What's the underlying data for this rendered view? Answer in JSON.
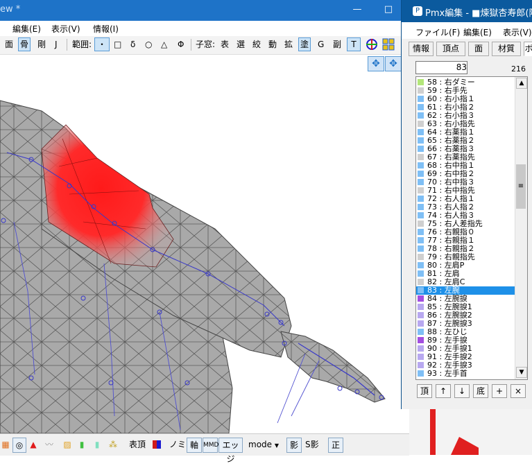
{
  "main": {
    "title": "ew *",
    "menu": [
      "編集(E)",
      "表示(V)",
      "情報(I)"
    ],
    "toolbar": {
      "mode_items": [
        "面",
        "骨",
        "剛",
        "J"
      ],
      "range_label": "範囲:",
      "range_items": [
        "・",
        "□",
        "δ",
        "○",
        "△",
        "Φ"
      ],
      "child_label": "子窓:",
      "child_items": [
        "表",
        "選",
        "絞",
        "動",
        "拡",
        "塗",
        "G",
        "副",
        "T"
      ]
    },
    "bottom": {
      "show_top": "表頂",
      "nomi": "ノミ",
      "axis": "軸",
      "mmd": "MMD",
      "edge": "エッジ",
      "mode": "mode",
      "shadow": "影",
      "s_shadow": "S影",
      "seimen": "正"
    }
  },
  "pmx": {
    "title": "Pmx編集 - ■煉獄杏寿郎(隊服",
    "menu": [
      "ファイル(F)",
      "編集(E)",
      "表示(V)"
    ],
    "tabs": [
      "情報",
      "頂点",
      "面",
      "材質",
      "ボ"
    ],
    "index_value": "83",
    "count": "216",
    "bones": [
      {
        "label": "58 : 右ダミー",
        "color": "#b3e67a"
      },
      {
        "label": "59 : 右手先",
        "color": "#cfcfcf"
      },
      {
        "label": "60 : 右小指１",
        "color": "#7fbff5"
      },
      {
        "label": "61 : 右小指２",
        "color": "#7fbff5"
      },
      {
        "label": "62 : 右小指３",
        "color": "#7fbff5"
      },
      {
        "label": "63 : 右小指先",
        "color": "#cfcfcf"
      },
      {
        "label": "64 : 右薬指１",
        "color": "#7fbff5"
      },
      {
        "label": "65 : 右薬指２",
        "color": "#7fbff5"
      },
      {
        "label": "66 : 右薬指３",
        "color": "#7fbff5"
      },
      {
        "label": "67 : 右薬指先",
        "color": "#cfcfcf"
      },
      {
        "label": "68 : 右中指１",
        "color": "#7fbff5"
      },
      {
        "label": "69 : 右中指２",
        "color": "#7fbff5"
      },
      {
        "label": "70 : 右中指３",
        "color": "#7fbff5"
      },
      {
        "label": "71 : 右中指先",
        "color": "#cfcfcf"
      },
      {
        "label": "72 : 右人指１",
        "color": "#7fbff5"
      },
      {
        "label": "73 : 右人指２",
        "color": "#7fbff5"
      },
      {
        "label": "74 : 右人指３",
        "color": "#7fbff5"
      },
      {
        "label": "75 : 右人差指先",
        "color": "#cfcfcf"
      },
      {
        "label": "76 : 右親指０",
        "color": "#7fbff5"
      },
      {
        "label": "77 : 右親指１",
        "color": "#7fbff5"
      },
      {
        "label": "78 : 右親指２",
        "color": "#7fbff5"
      },
      {
        "label": "79 : 右親指先",
        "color": "#cfcfcf"
      },
      {
        "label": "80 : 左肩P",
        "color": "#7fbff5"
      },
      {
        "label": "81 : 左肩",
        "color": "#7fbff5"
      },
      {
        "label": "82 : 左肩C",
        "color": "#cfcfcf"
      },
      {
        "label": "83 : 左腕",
        "color": "#7fbff5",
        "selected": true
      },
      {
        "label": "84 : 左腕捩",
        "color": "#a34ee0"
      },
      {
        "label": "85 : 左腕捩1",
        "color": "#b8a8f0"
      },
      {
        "label": "86 : 左腕捩2",
        "color": "#b8a8f0"
      },
      {
        "label": "87 : 左腕捩3",
        "color": "#b8a8f0"
      },
      {
        "label": "88 : 左ひじ",
        "color": "#7fbff5"
      },
      {
        "label": "89 : 左手捩",
        "color": "#a34ee0"
      },
      {
        "label": "90 : 左手捩1",
        "color": "#b8a8f0"
      },
      {
        "label": "91 : 左手捩2",
        "color": "#b8a8f0"
      },
      {
        "label": "92 : 左手捩3",
        "color": "#b8a8f0"
      },
      {
        "label": "93 : 左手首",
        "color": "#7fbff5"
      }
    ],
    "buttons": [
      "頂",
      "↑",
      "↓",
      "底",
      "+",
      "×"
    ]
  }
}
